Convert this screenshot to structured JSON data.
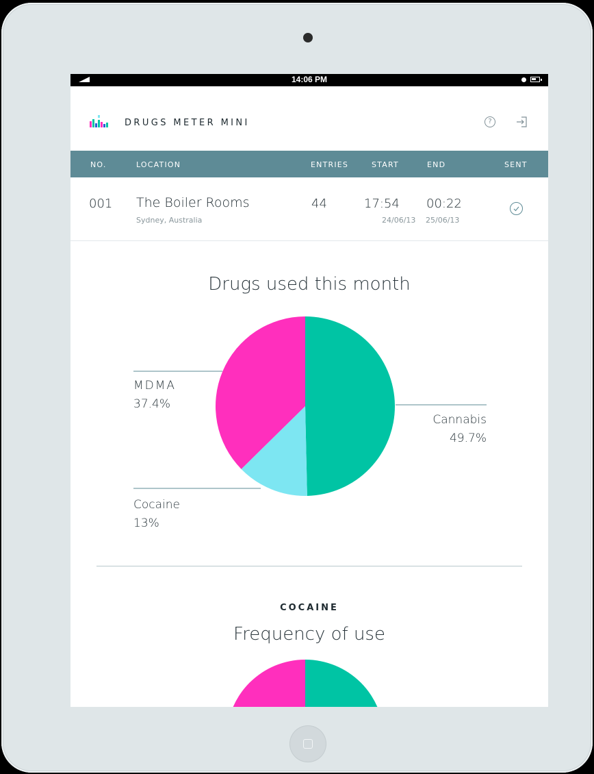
{
  "status_bar": {
    "time": "14:06 PM"
  },
  "app": {
    "title": "DRUGS METER MINI"
  },
  "table": {
    "headers": {
      "no": "NO.",
      "location": "LOCATION",
      "entries": "ENTRIES",
      "start": "START",
      "end": "END",
      "sent": "SENT"
    },
    "row": {
      "no": "001",
      "location": "The Boiler Rooms",
      "city": "Sydney, Australia",
      "entries": "44",
      "start_time": "17:54",
      "start_date": "24/06/13",
      "end_time": "00:22",
      "end_date": "25/06/13"
    }
  },
  "chart_data": {
    "type": "pie",
    "title": "Drugs used this month",
    "slices": [
      {
        "label": "Cannabis",
        "value": 49.7,
        "display": "49.7%",
        "color": "#00c4a4"
      },
      {
        "label": "Cocaine",
        "value": 13,
        "display": "13%",
        "color": "#7de6f2"
      },
      {
        "label": "MDMA",
        "value": 37.4,
        "display": "37.4%",
        "color": "#ff2fbd"
      }
    ]
  },
  "section2": {
    "label": "COCAINE",
    "title": "Frequency of use",
    "colors": {
      "left": "#ff2fbd",
      "right": "#00c4a4"
    }
  },
  "colors": {
    "header_bg": "#5e8b96",
    "accent": "#5e8b96"
  }
}
